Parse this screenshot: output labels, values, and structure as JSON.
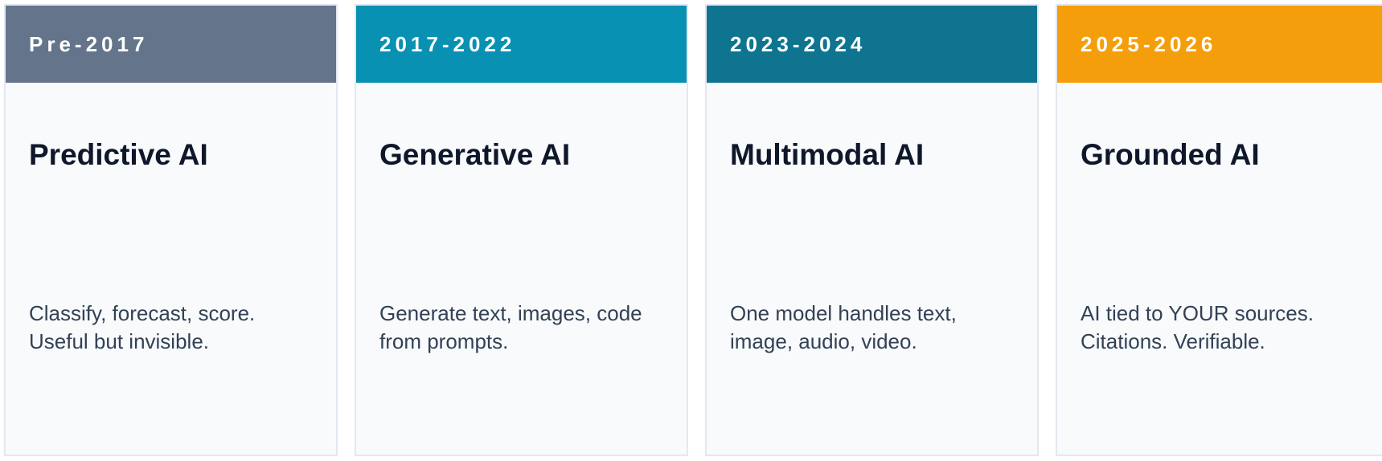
{
  "cards": [
    {
      "era": "Pre-2017",
      "title": "Predictive AI",
      "description_lines": [
        "Classify, forecast, score.",
        "Useful but invisible."
      ],
      "header_color": "#64748b"
    },
    {
      "era": "2017-2022",
      "title": "Generative AI",
      "description_lines": [
        "Generate text, images, code",
        "from prompts."
      ],
      "header_color": "#0891b2"
    },
    {
      "era": "2023-2024",
      "title": "Multimodal AI",
      "description_lines": [
        "One model handles text,",
        "image, audio, video."
      ],
      "header_color": "#0e7490"
    },
    {
      "era": "2025-2026",
      "title": "Grounded AI",
      "description_lines": [
        "AI tied to YOUR sources.",
        "Citations. Verifiable."
      ],
      "header_color": "#f59e0b"
    }
  ]
}
